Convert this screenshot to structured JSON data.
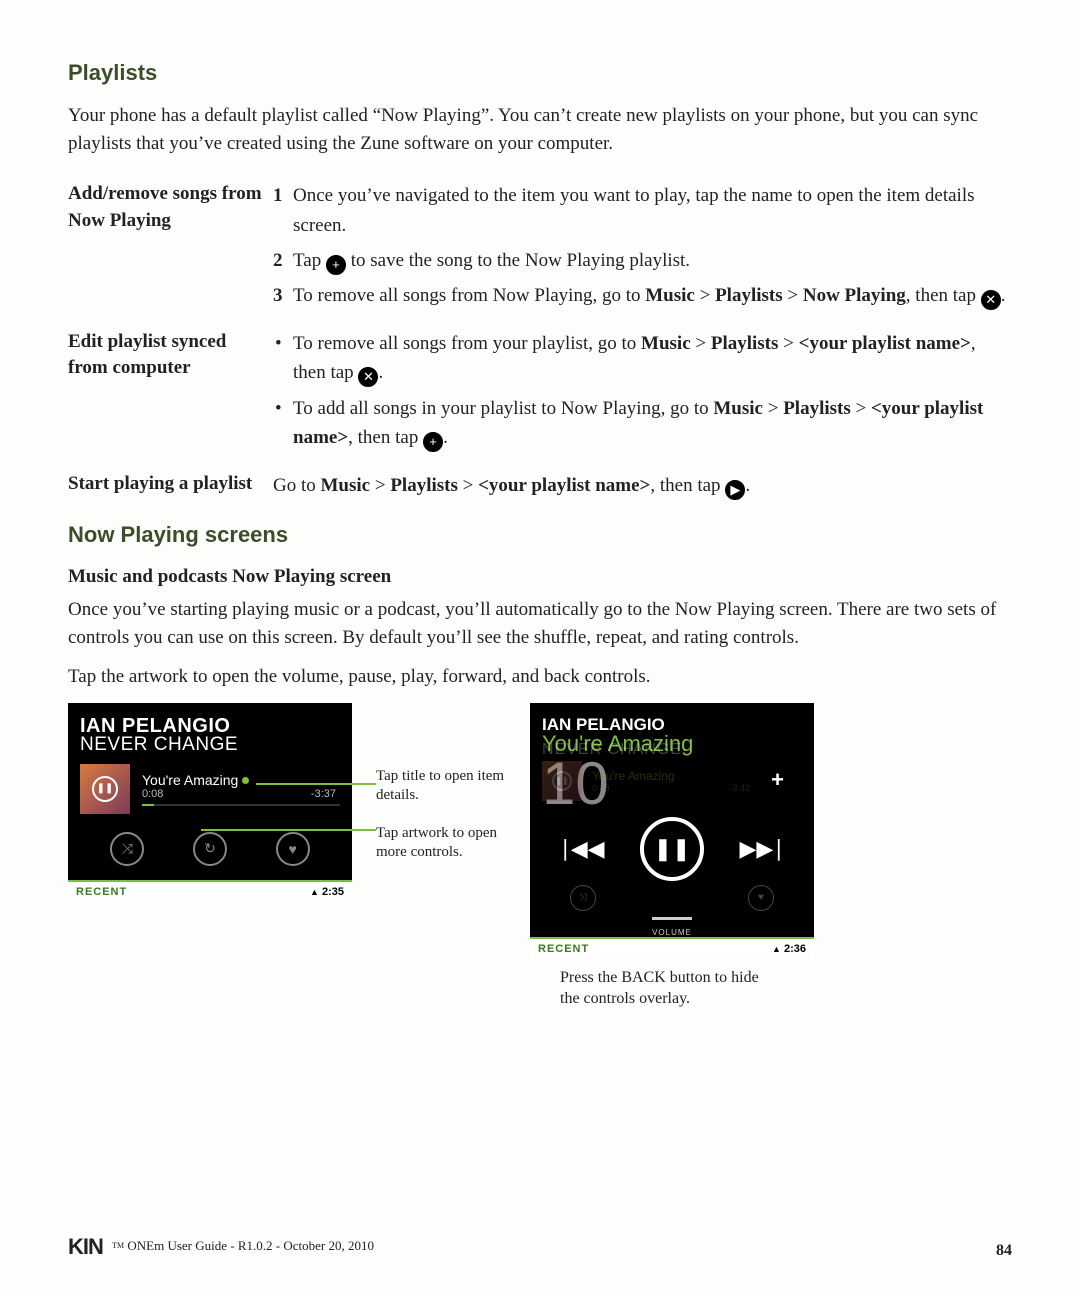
{
  "sections": {
    "playlists_heading": "Playlists",
    "playlists_intro": "Your phone has a default playlist called “Now Playing”. You can’t create new playlists on your phone, but you can sync playlists that you’ve created using the Zune software on your computer.",
    "row1_left": "Add/remove songs from Now Playing",
    "row1_1a": "Once you’ve navigated to the item you want to play, tap the name to open the item details screen.",
    "row1_2a": "Tap ",
    "row1_2b": " to save the song to the Now Playing playlist.",
    "row1_3a": "To remove all songs from Now Playing, go to ",
    "row1_3_music": "Music",
    "row1_3_gt1": " > ",
    "row1_3_pl": "Playlists",
    "row1_3_gt2": " > ",
    "row1_3_np": "Now Playing",
    "row1_3b": ", then tap ",
    "row2_left": "Edit playlist synced from computer",
    "row2_b1a": "To remove all songs from your playlist, go to ",
    "row2_b1_yp": "<your playlist name>",
    "row2_b1b": ", then tap ",
    "row2_b2a": "To add all songs in your playlist to Now Playing, go to ",
    "row2_b2b": ", then tap ",
    "row3_left": "Start playing a playlist",
    "row3_a": "Go to ",
    "row3_b": ", then tap ",
    "nps_heading": "Now Playing screens",
    "nps_sub": "Music and podcasts Now Playing screen",
    "nps_p1": "Once you’ve starting playing music or a podcast, you’ll automatically go to the Now Playing screen. There are two sets of controls you can use on this screen. By default you’ll see the shuffle, repeat, and rating controls.",
    "nps_p2": "Tap the artwork to open the volume, pause, play, forward, and back controls."
  },
  "callouts": {
    "c1": "Tap title to open item details.",
    "c2": "Tap artwork to open more controls.",
    "caption2a": "Press the BACK button to hide",
    "caption2b": "the controls overlay."
  },
  "phone": {
    "artist": "IAN PELANGIO",
    "album": "NEVER CHANGE",
    "song": "You're Amazing",
    "elapsed": "0:08",
    "remaining": "-3:37",
    "recent": "RECENT",
    "clock1": "2:35",
    "clock2": "2:36",
    "big_num": "10",
    "volume_label": "VOLUME"
  },
  "footer": {
    "logo": "KIN",
    "text": "ONEm User Guide - R1.0.2 - October 20, 2010",
    "page": "84"
  },
  "glyphs": {
    "gt": " > ",
    "period": "."
  }
}
